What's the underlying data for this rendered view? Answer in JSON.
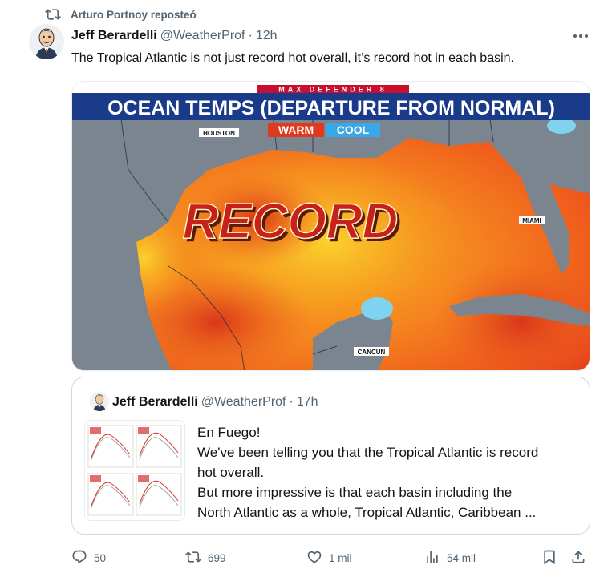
{
  "repost": {
    "label": "Arturo Portnoy reposteó",
    "icon": "repost-icon"
  },
  "tweet": {
    "author_name": "Jeff Berardelli",
    "author_handle": "@WeatherProf",
    "separator": "·",
    "time": "12h",
    "text": "The Tropical Atlantic is not just record hot overall, it’s record hot in each basin.",
    "more_icon": "more-icon"
  },
  "media": {
    "banner_top": "MAX DEFENDER 8",
    "headline": "OCEAN TEMPS (DEPARTURE FROM NORMAL)",
    "legend_warm": "WARM",
    "legend_cool": "COOL",
    "label_houston": "HOUSTON",
    "label_miami": "MIAMI",
    "label_cancun": "CANCUN",
    "overlay_word": "RECORD"
  },
  "quote": {
    "author_name": "Jeff Berardelli",
    "author_handle": "@WeatherProf",
    "separator": "·",
    "time": "17h",
    "lines": [
      "En Fuego!",
      "We've been telling you that the Tropical Atlantic is record",
      "hot overall.",
      "But more impressive is that each basin including the",
      "North Atlantic as a whole, Tropical Atlantic, Caribbean ..."
    ]
  },
  "actions": {
    "replies": "50",
    "reposts": "699",
    "likes": "1 mil",
    "views": "54 mil",
    "bookmark_icon": "bookmark-icon",
    "share_icon": "share-icon"
  },
  "colors": {
    "text_primary": "#0f1419",
    "text_secondary": "#536471",
    "repost_green": "#00ba7c",
    "headline_blue": "#1a3a8a",
    "banner_red": "#c8102e",
    "warm_red": "#e03a1e",
    "cool_blue": "#3aa8e8"
  }
}
